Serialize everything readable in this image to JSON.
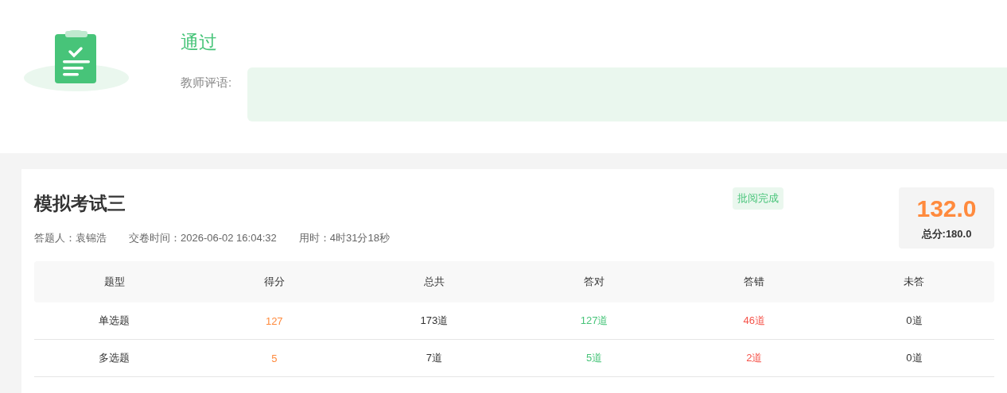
{
  "result": {
    "status": "通过",
    "passed": true,
    "comment_label": "教师评语:"
  },
  "exam": {
    "title": "模拟考试三",
    "badge": "批阅完成",
    "meta": [
      {
        "label": "答题人：",
        "value": "袁锦浩"
      },
      {
        "label": "交卷时间：",
        "value": "2026-06-02 16:04:32"
      },
      {
        "label": "用时：",
        "value": "4时31分18秒"
      }
    ],
    "score": "132.0",
    "total": "总分:180.0"
  },
  "table": {
    "columns": [
      "题型",
      "得分",
      "总共",
      "答对",
      "答错",
      "未答"
    ],
    "rows": [
      {
        "type": "单选题",
        "score": "127",
        "total": "173道",
        "correct": "127道",
        "wrong": "46道",
        "unanswered": "0道"
      },
      {
        "type": "多选题",
        "score": "5",
        "total": "7道",
        "correct": "5道",
        "wrong": "2道",
        "unanswered": "0道"
      }
    ]
  }
}
